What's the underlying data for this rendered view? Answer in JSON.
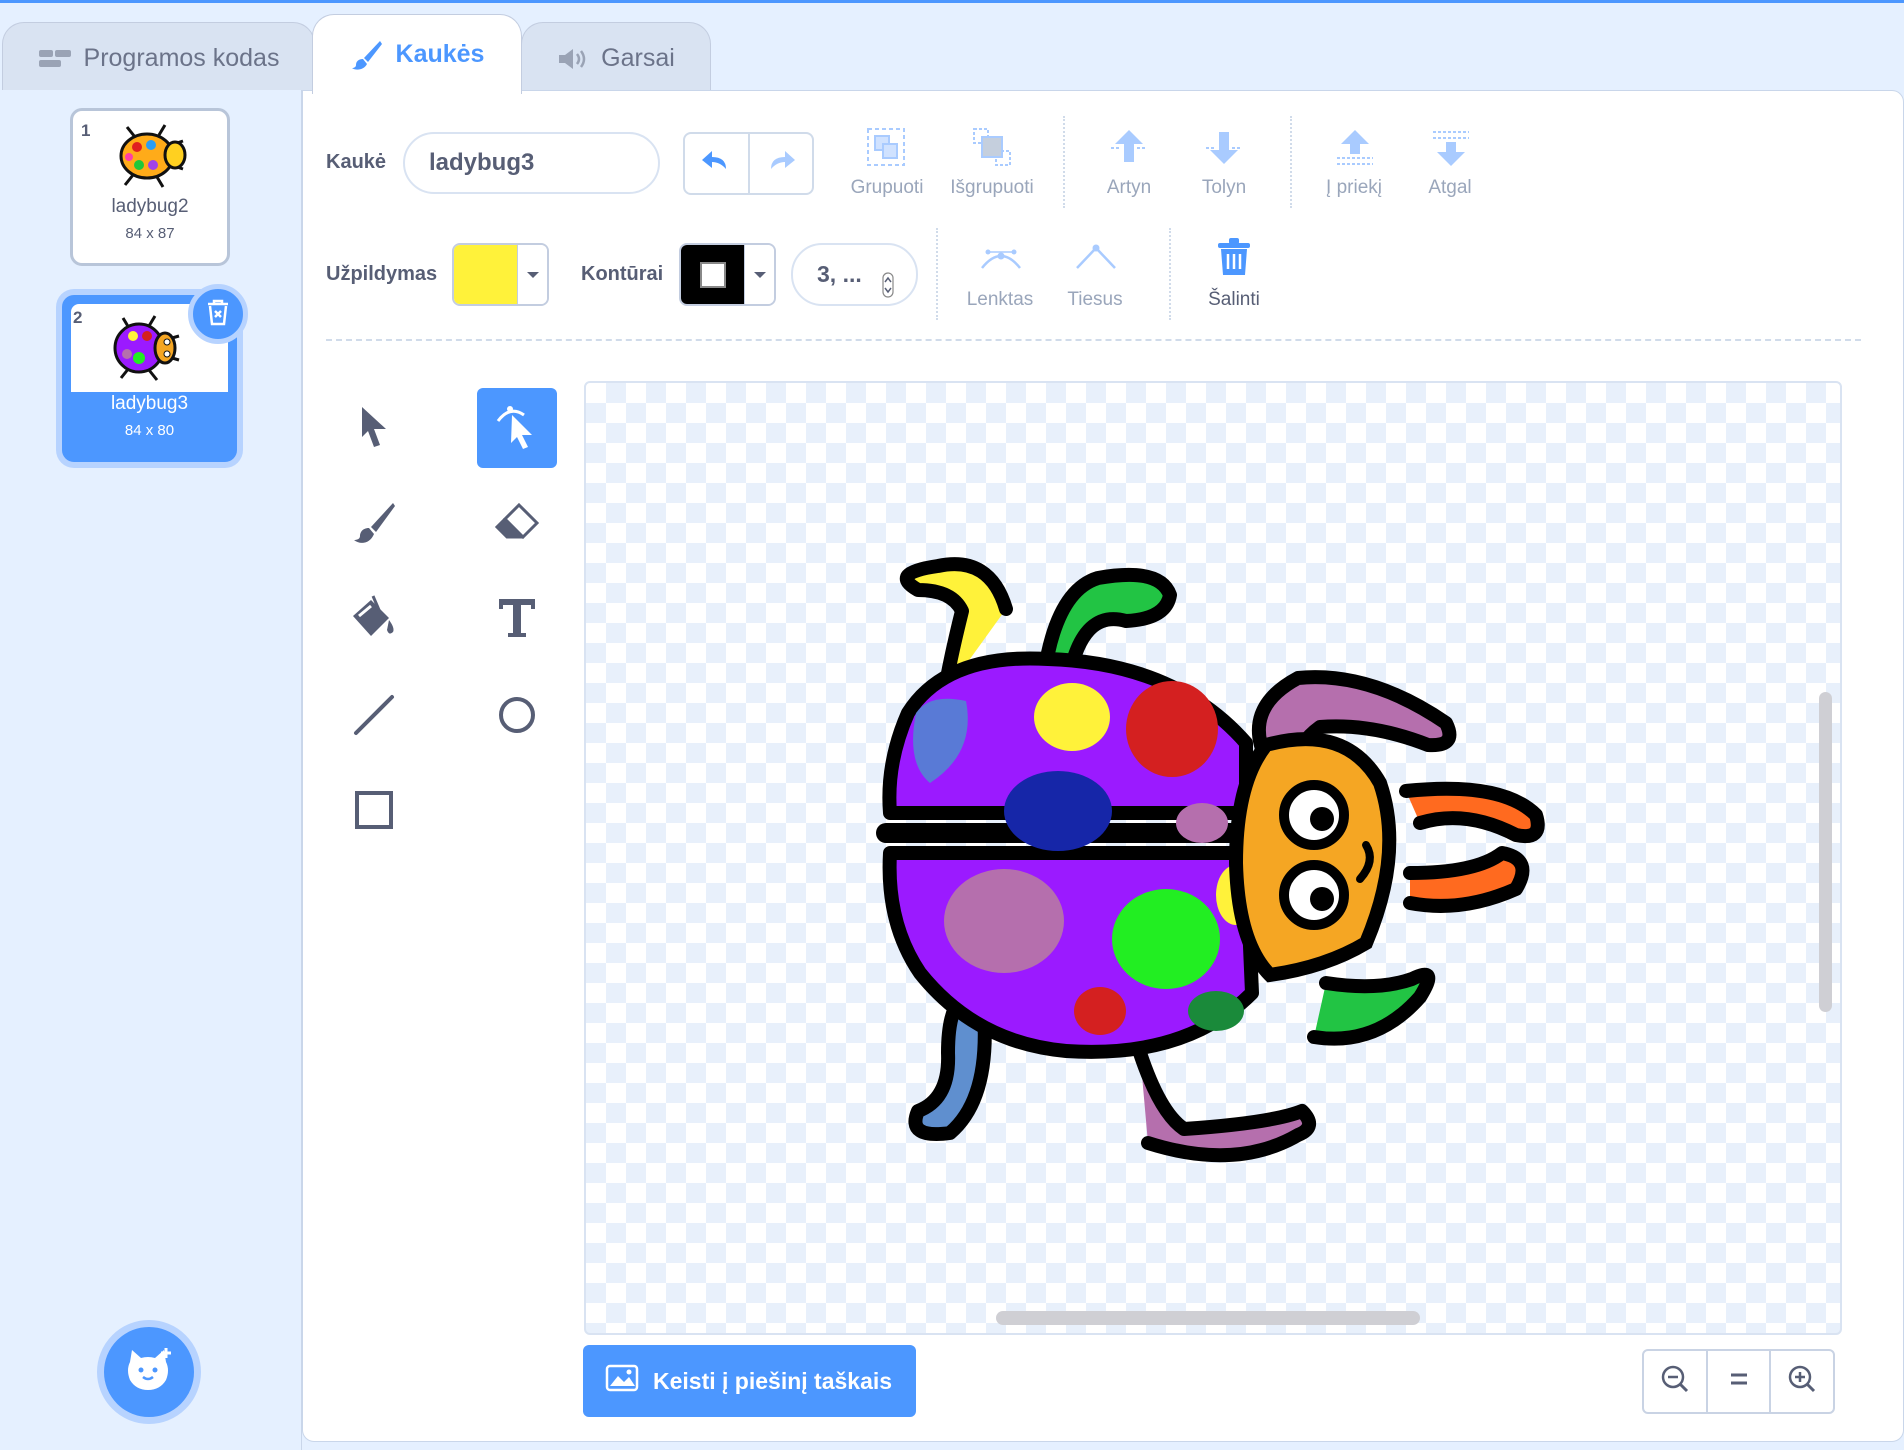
{
  "tabs": [
    {
      "label": "Programos kodas",
      "icon": "code-icon"
    },
    {
      "label": "Kaukės",
      "icon": "brush-icon"
    },
    {
      "label": "Garsai",
      "icon": "speaker-icon"
    }
  ],
  "costumes": [
    {
      "index": "1",
      "name": "ladybug2",
      "size": "84 x 87"
    },
    {
      "index": "2",
      "name": "ladybug3",
      "size": "84 x 80"
    }
  ],
  "toolbar": {
    "costume_label": "Kaukė",
    "costume_name": "ladybug3",
    "group": "Grupuoti",
    "ungroup": "Išgrupuoti",
    "forward": "Artyn",
    "backward": "Tolyn",
    "front": "Į priekį",
    "back": "Atgal",
    "fill_label": "Užpildymas",
    "fill_color": "#fff23a",
    "outline_label": "Kontūrai",
    "outline_color": "#000000",
    "outline_width": "3, ...",
    "curved": "Lenktas",
    "pointed": "Tiesus",
    "delete": "Šalinti"
  },
  "bitmap_button": "Keisti į piešinį taškais",
  "colors": {
    "accent": "#4c97ff",
    "text": "#575e75",
    "disabled": "#9aa6bb"
  }
}
